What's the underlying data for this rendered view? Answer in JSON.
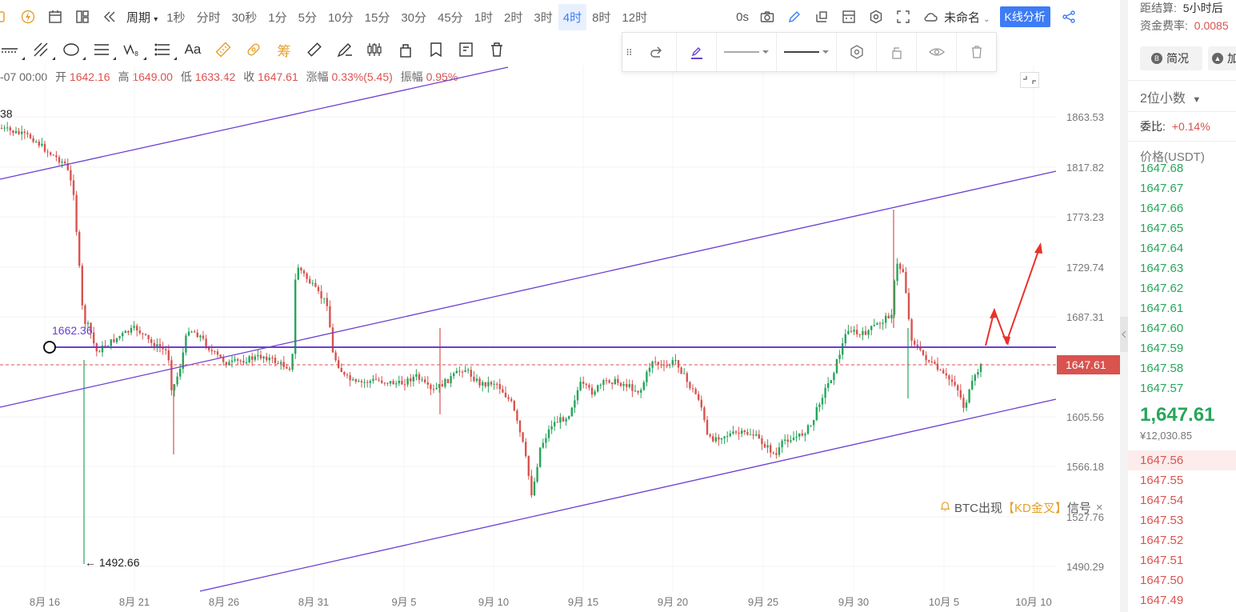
{
  "toolbar": {
    "period_label": "周期",
    "timeframes": [
      "1秒",
      "分时",
      "30秒",
      "1分",
      "5分",
      "10分",
      "15分",
      "30分",
      "45分",
      "1时",
      "2时",
      "3时",
      "4时",
      "8时",
      "12时"
    ],
    "active_timeframe": "4时",
    "countdown": "0s",
    "layout_name": "未命名",
    "kline_analysis": "K线分析"
  },
  "drawing_toolbar": {
    "text_tool": "Aa",
    "chip_tool": "筹"
  },
  "ohlc": {
    "date": "-07 00:00",
    "open_label": "开",
    "open": "1642.16",
    "high_label": "高",
    "high": "1649.00",
    "low_label": "低",
    "low": "1633.42",
    "close_label": "收",
    "close": "1647.61",
    "change_label": "涨幅",
    "change": "0.33%(5.45)",
    "amplitude_label": "振幅",
    "amplitude": "0.95%"
  },
  "chart_data": {
    "type": "candlestick",
    "price_axis": [
      "1863.53",
      "1817.82",
      "1773.23",
      "1729.74",
      "1687.31",
      "1605.56",
      "1566.18",
      "1527.76",
      "1490.29"
    ],
    "date_axis": [
      "8月 16",
      "8月 21",
      "8月 26",
      "8月 31",
      "9月 5",
      "9月 10",
      "9月 15",
      "9月 20",
      "9月 25",
      "9月 30",
      "10月 5",
      "10月 10"
    ],
    "current_price": "1647.61",
    "horizontal_line_label": "1662.36",
    "low_marker": "1492.66",
    "top_left_marker": "38",
    "colors": {
      "up": "#26a65b",
      "down": "#d9534f",
      "drawing": "#6a3fd0",
      "arrow": "#e8322a"
    }
  },
  "signal": {
    "prefix": "BTC出现",
    "text": "【KD金叉】",
    "suffix": "信号",
    "close": "×"
  },
  "right_panel": {
    "settlement_label": "距结算:",
    "settlement_value": "5小时后",
    "funding_label": "资金费率:",
    "funding_value": "0.0085",
    "tab_overview": "简况",
    "tab_add": "加",
    "tab_overview_icon": "B",
    "decimal_select": "2位小数",
    "ratio_label": "委比:",
    "ratio_value": "+0.14%",
    "price_header": "价格(USDT)",
    "bids": [
      "1647.68",
      "1647.67",
      "1647.66",
      "1647.65",
      "1647.64",
      "1647.63",
      "1647.62",
      "1647.61",
      "1647.60",
      "1647.59",
      "1647.58",
      "1647.57"
    ],
    "last_price": "1,647.61",
    "last_price_cny": "¥12,030.85",
    "asks": [
      "1647.56",
      "1647.55",
      "1647.54",
      "1647.53",
      "1647.52",
      "1647.51",
      "1647.50",
      "1647.49"
    ]
  }
}
